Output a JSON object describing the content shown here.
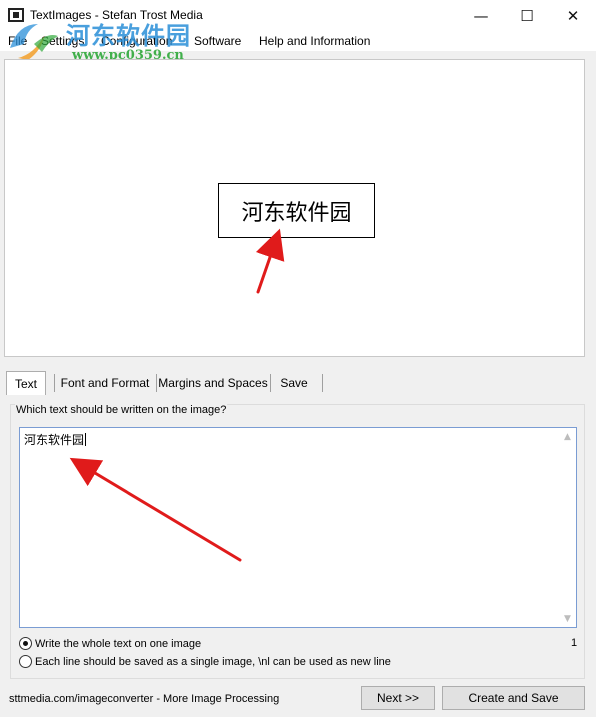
{
  "window": {
    "title": "TextImages - Stefan Trost Media",
    "minimize_glyph": "—",
    "maximize_glyph": "☐",
    "close_glyph": "✕"
  },
  "menu": {
    "items": [
      "File",
      "Settings",
      "Configuration",
      "Software",
      "Help and Information"
    ]
  },
  "watermark": {
    "site_name": "河东软件园",
    "url": "www.pc0359.cn"
  },
  "preview": {
    "rendered_text": "河东软件园"
  },
  "tabs": [
    "Text",
    "Font and Format",
    "Margins and Spaces",
    "Save"
  ],
  "text_tab": {
    "group_label": "Which text should be written on the image?",
    "text_value": "河东软件园",
    "line_count": "1",
    "options": [
      {
        "label": "Write the whole text on one image",
        "checked": true
      },
      {
        "label": "Each line should be saved as a single image, \\nl can be used as new line",
        "checked": false
      }
    ]
  },
  "footer": {
    "link_text": "sttmedia.com/imageconverter - More Image Processing",
    "next_button": "Next >>",
    "create_button": "Create and Save"
  },
  "colors": {
    "annotation_arrow": "#e01b1b",
    "watermark_blue": "#2a8fd8",
    "watermark_green": "#2fa83a"
  }
}
